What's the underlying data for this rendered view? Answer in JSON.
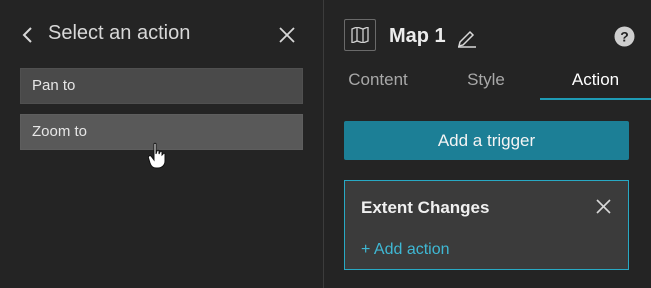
{
  "left_panel": {
    "back_icon": "chevron-left-icon",
    "title": "Select an action",
    "close_icon": "close-icon",
    "actions": [
      {
        "label": "Pan to"
      },
      {
        "label": "Zoom to"
      }
    ]
  },
  "right_panel": {
    "widget_icon": "map-icon",
    "widget_title": "Map 1",
    "edit_icon": "pencil-icon",
    "help_icon": "help-icon",
    "tabs": [
      {
        "label": "Content"
      },
      {
        "label": "Style"
      },
      {
        "label": "Action",
        "active": true
      }
    ],
    "add_trigger_label": "Add a trigger",
    "trigger": {
      "title": "Extent Changes",
      "close_icon": "close-icon",
      "add_action_label": "+ Add action"
    }
  },
  "colors": {
    "accent": "#1c7f96",
    "accent_border": "#28a9c4",
    "link": "#3fb8d4",
    "background": "#242424"
  }
}
